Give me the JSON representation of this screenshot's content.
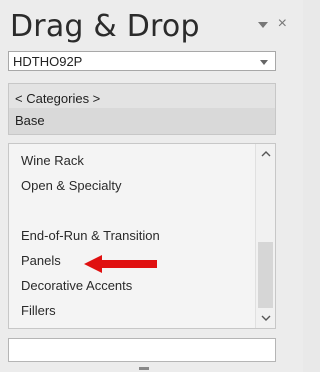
{
  "panel": {
    "title": "Drag & Drop",
    "controls": {
      "dropdown_icon": "chevron-down",
      "close_glyph": "×"
    }
  },
  "catalog_combo": {
    "value": "HDTHO92P"
  },
  "categories": {
    "header": "< Categories >",
    "selected": "Base"
  },
  "items": [
    "Wine Rack",
    "Open & Specialty",
    "",
    "End-of-Run & Transition",
    "Panels",
    "Decorative Accents",
    "Fillers"
  ],
  "scroll": {
    "position": 0.6
  },
  "annotation": {
    "arrow_color": "#e01010",
    "target_item": "Panels"
  },
  "search": {
    "value": ""
  }
}
